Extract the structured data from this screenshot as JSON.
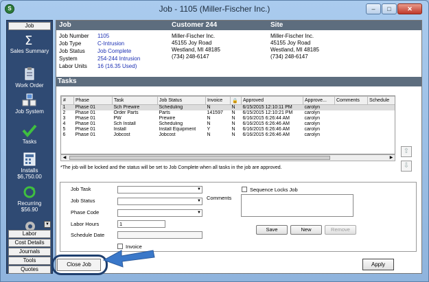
{
  "window": {
    "title": "Job - 1105 (Miller-Fischer Inc.)",
    "controls": [
      "–",
      "□",
      "✕"
    ]
  },
  "sidebar": {
    "top_tab": "Job",
    "items": [
      {
        "name": "sales-summary",
        "label": "Sales Summary",
        "icon": "sigma-icon",
        "sub": ""
      },
      {
        "name": "work-order",
        "label": "Work Order",
        "icon": "clipboard-icon",
        "sub": ""
      },
      {
        "name": "job-system",
        "label": "Job System",
        "icon": "network-icon",
        "sub": ""
      },
      {
        "name": "tasks",
        "label": "Tasks",
        "icon": "checkmark-icon",
        "sub": ""
      },
      {
        "name": "installs",
        "label": "Installs",
        "icon": "calculator-icon",
        "sub": "$6,750.00"
      },
      {
        "name": "recurring",
        "label": "Recurring",
        "icon": "recycle-icon",
        "sub": "$56.90"
      }
    ],
    "bottom_tabs": [
      "Labor",
      "Cost Details",
      "Journals",
      "Tools",
      "Quotes"
    ]
  },
  "header": {
    "job_title": "Job",
    "customer_title": "Customer 244",
    "site_title": "Site"
  },
  "job_info": [
    {
      "label": "Job Number",
      "value": "1105"
    },
    {
      "label": "Job Type",
      "value": "C-Intrusion"
    },
    {
      "label": "Job Status",
      "value": "Job Complete"
    },
    {
      "label": "System",
      "value": "254-244 Intrusion"
    },
    {
      "label": "Labor Units",
      "value": "16 (16.35 Used)"
    }
  ],
  "customer": [
    "Miller-Fischer Inc.",
    "45155 Joy Road",
    "Westland, MI 48185",
    "(734) 248-6147"
  ],
  "site": [
    "Miller-Fischer Inc.",
    "45155 Joy Road",
    "Westland, MI 48185",
    "(734) 248-6147"
  ],
  "tasks_title": "Tasks",
  "grid": {
    "columns": [
      "#",
      "Phase",
      "Task",
      "Job Status",
      "Invoice",
      "🔒",
      "Approved",
      "Approve...",
      "Comments",
      "Schedule"
    ],
    "rows": [
      [
        "1",
        "Phase 01",
        "Sch Prewire",
        "Scheduling",
        "N",
        "N",
        "6/15/2015 12:10:11 PM",
        "carolyn",
        "",
        ""
      ],
      [
        "2",
        "Phase 01",
        "Order Parts",
        "Parts",
        "141597",
        "N",
        "6/15/2015 12:10:21 PM",
        "carolyn",
        "",
        ""
      ],
      [
        "3",
        "Phase 01",
        "PW",
        "Prewire",
        "N",
        "N",
        "6/16/2015 6:26:44 AM",
        "carolyn",
        "",
        ""
      ],
      [
        "4",
        "Phase 01",
        "Sch Install",
        "Scheduling",
        "N",
        "N",
        "6/16/2015 6:26:46 AM",
        "carolyn",
        "",
        ""
      ],
      [
        "5",
        "Phase 01",
        "Install",
        "Install Equipment",
        "Y",
        "N",
        "6/16/2015 6:26:46 AM",
        "carolyn",
        "",
        ""
      ],
      [
        "6",
        "Phase 01",
        "Jobcost",
        "Jobcost",
        "N",
        "N",
        "6/16/2015 6:26:46 AM",
        "carolyn",
        "",
        ""
      ]
    ]
  },
  "note": "*The job will be locked and the status will be set to Job Complete when all tasks in the job are approved.",
  "form": {
    "job_task_label": "Job Task",
    "job_status_label": "Job Status",
    "phase_code_label": "Phase Code",
    "labor_hours_label": "Labor Hours",
    "labor_hours_value": "1",
    "schedule_date_label": "Schedule Date",
    "invoice_label": "Invoice",
    "comments_label": "Comments",
    "sequence_locks_label": "Sequence Locks Job",
    "save_label": "Save",
    "new_label": "New",
    "remove_label": "Remove"
  },
  "footer": {
    "close_job_label": "Close Job",
    "apply_label": "Apply"
  },
  "colors": {
    "accent_blue": "#1b2fb3",
    "sidebar": "#2f4a73",
    "band": "#5d6d7e",
    "arrow": "#3a78c9"
  }
}
